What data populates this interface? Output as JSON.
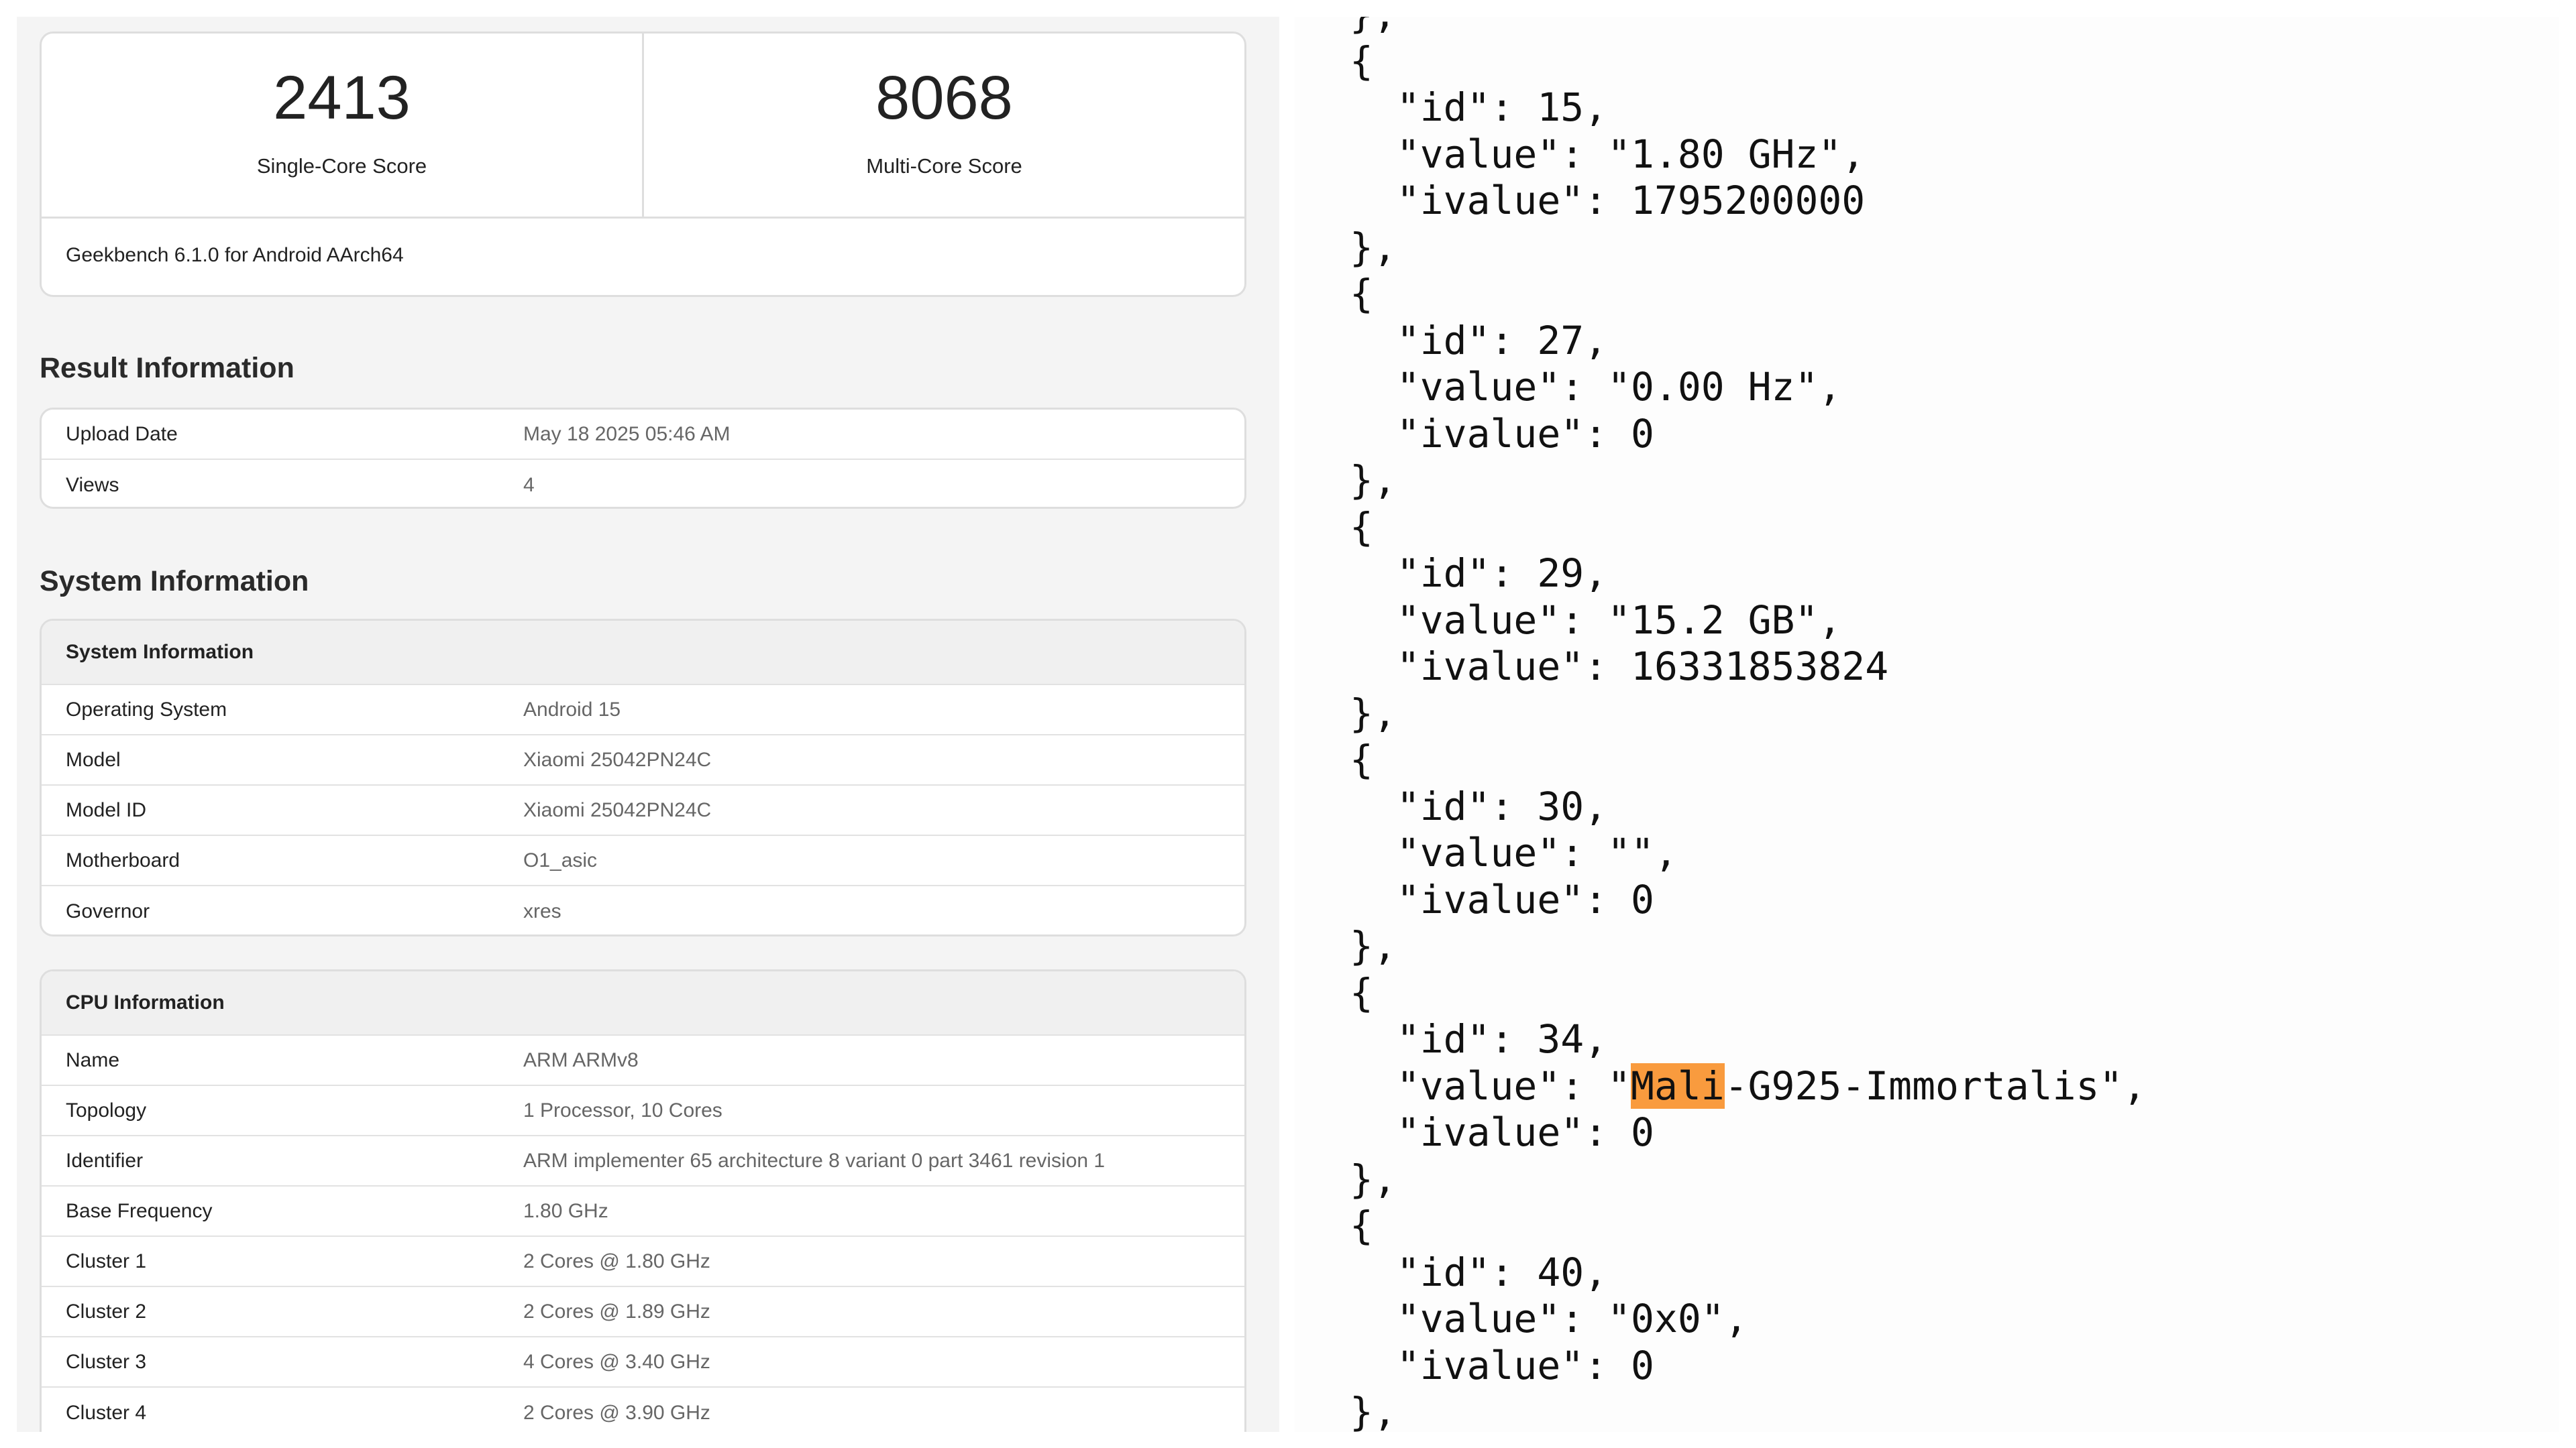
{
  "scores": {
    "single_value": "2413",
    "single_label": "Single-Core Score",
    "multi_value": "8068",
    "multi_label": "Multi-Core Score",
    "version": "Geekbench 6.1.0 for Android AArch64"
  },
  "result_info": {
    "heading": "Result Information",
    "rows": [
      {
        "label": "Upload Date",
        "value": "May 18 2025 05:46 AM"
      },
      {
        "label": "Views",
        "value": "4"
      }
    ]
  },
  "system_info": {
    "heading": "System Information",
    "card_title": "System Information",
    "rows": [
      {
        "label": "Operating System",
        "value": "Android 15"
      },
      {
        "label": "Model",
        "value": "Xiaomi 25042PN24C"
      },
      {
        "label": "Model ID",
        "value": "Xiaomi 25042PN24C"
      },
      {
        "label": "Motherboard",
        "value": "O1_asic"
      },
      {
        "label": "Governor",
        "value": "xres"
      }
    ]
  },
  "cpu_info": {
    "card_title": "CPU Information",
    "rows": [
      {
        "label": "Name",
        "value": "ARM ARMv8"
      },
      {
        "label": "Topology",
        "value": "1 Processor, 10 Cores"
      },
      {
        "label": "Identifier",
        "value": "ARM implementer 65 architecture 8 variant 0 part 3461 revision 1"
      },
      {
        "label": "Base Frequency",
        "value": "1.80 GHz"
      },
      {
        "label": "Cluster 1",
        "value": "2 Cores @ 1.80 GHz"
      },
      {
        "label": "Cluster 2",
        "value": "2 Cores @ 1.89 GHz"
      },
      {
        "label": "Cluster 3",
        "value": "4 Cores @ 3.40 GHz"
      },
      {
        "label": "Cluster 4",
        "value": "2 Cores @ 3.90 GHz"
      }
    ]
  },
  "json_view": {
    "lines": [
      "},",
      "{",
      "  \"id\": 15,",
      "  \"value\": \"1.80 GHz\",",
      "  \"ivalue\": 1795200000",
      "},",
      "{",
      "  \"id\": 27,",
      "  \"value\": \"0.00 Hz\",",
      "  \"ivalue\": 0",
      "},",
      "{",
      "  \"id\": 29,",
      "  \"value\": \"15.2 GB\",",
      "  \"ivalue\": 16331853824",
      "},",
      "{",
      "  \"id\": 30,",
      "  \"value\": \"\",",
      "  \"ivalue\": 0",
      "},",
      "{",
      "  \"id\": 34,",
      "  \"value\": \"Mali-G925-Immortalis\",",
      "  \"ivalue\": 0",
      "},",
      "{",
      "  \"id\": 40,",
      "  \"value\": \"0x0\",",
      "  \"ivalue\": 0",
      "},"
    ],
    "highlight": {
      "line": 23,
      "before": "  \"value\": \"",
      "match": "Mali",
      "after": "-G925-Immortalis\",",
      "color": "#f99b3e"
    }
  }
}
